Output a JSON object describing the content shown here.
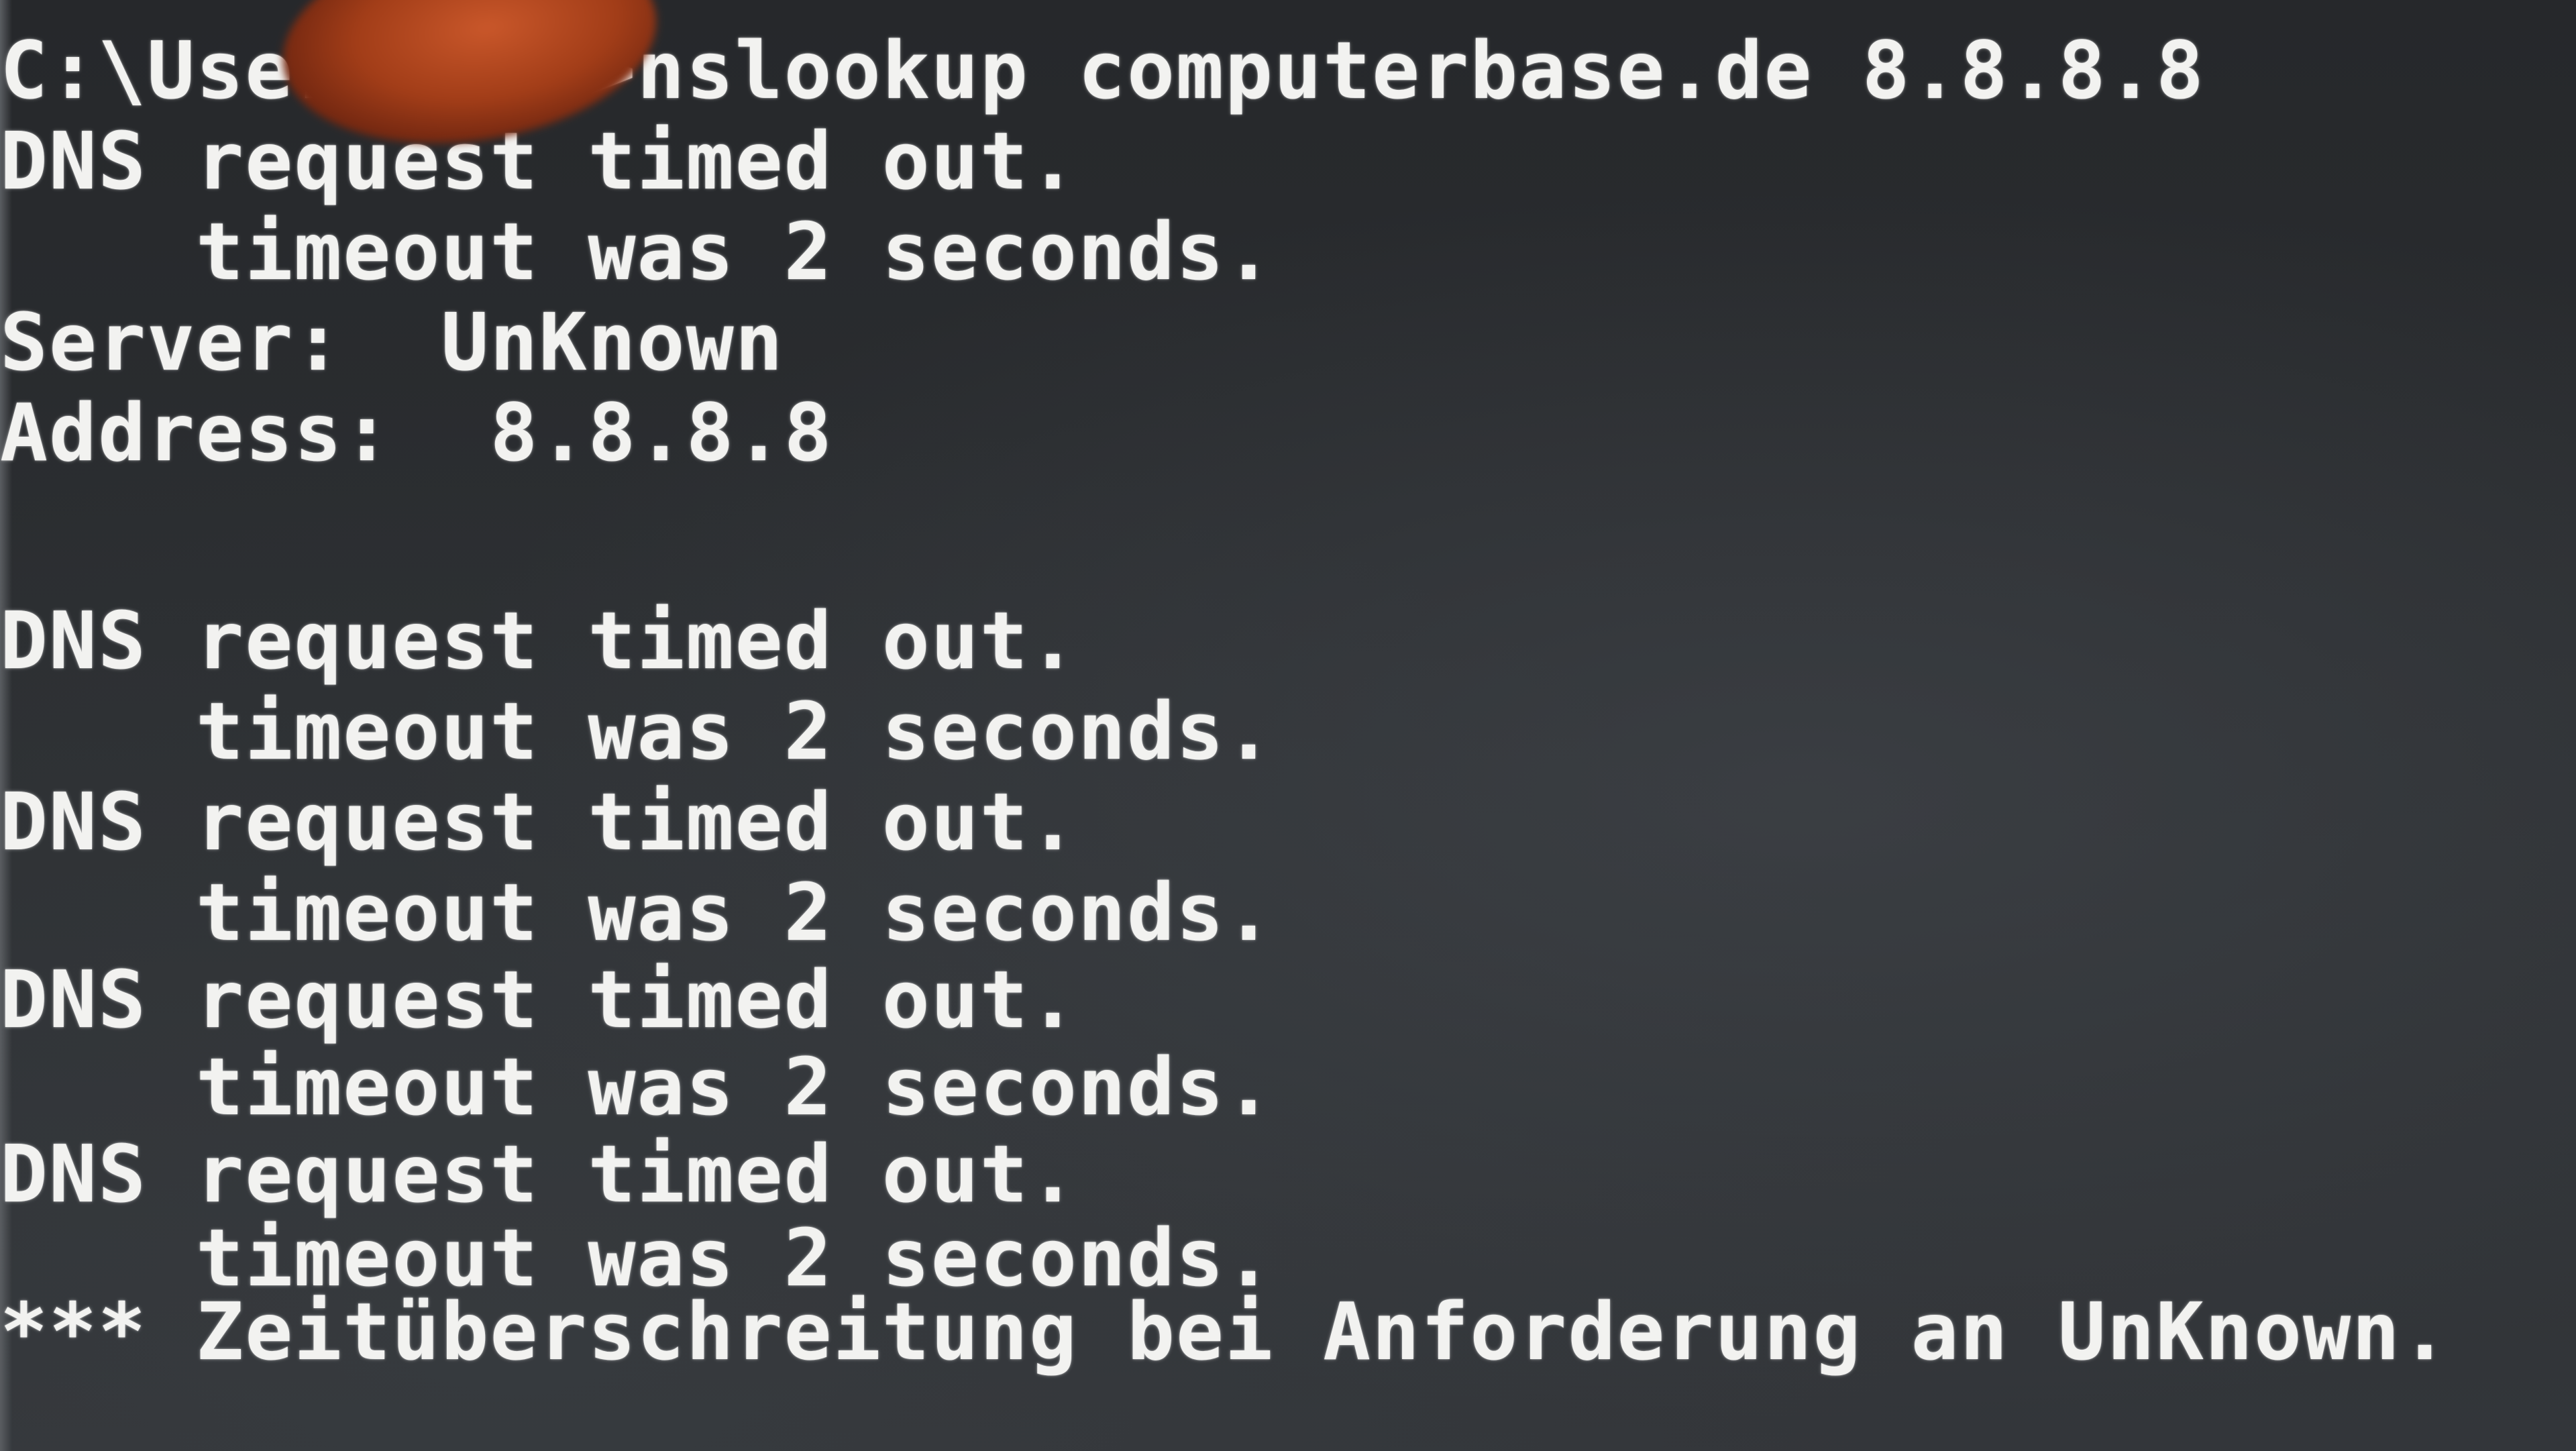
{
  "console": {
    "lines": [
      "C:\\Users\\   >nslookup computerbase.de 8.8.8.8",
      "DNS request timed out.",
      "    timeout was 2 seconds.",
      "Server:  UnKnown",
      "Address:  8.8.8.8",
      "",
      "DNS request timed out.",
      "    timeout was 2 seconds.",
      "DNS request timed out.",
      "    timeout was 2 seconds.",
      "DNS request timed out.",
      "    timeout was 2 seconds.",
      "DNS request timed out.",
      "    timeout was 2 seconds.",
      "*** Zeitüberschreitung bei Anforderung an UnKnown."
    ]
  }
}
